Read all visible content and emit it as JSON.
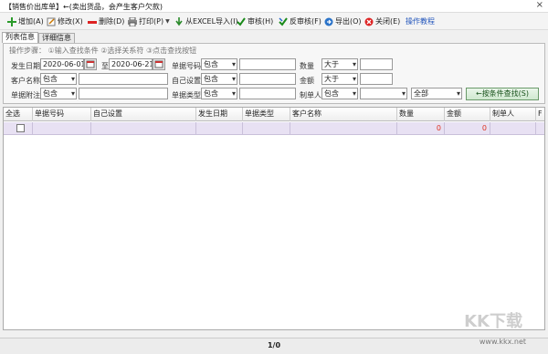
{
  "window": {
    "title": "【销售价出库单】←(卖出货品，会产生客户欠款)",
    "close": "×"
  },
  "toolbar": {
    "add": "增加(A)",
    "edit": "修改(X)",
    "delete": "删除(D)",
    "print": "打印(P)",
    "excel": "从EXCEL导入(I)",
    "audit": "审核(H)",
    "unaudit": "反审核(F)",
    "export": "导出(O)",
    "close": "关闭(E)",
    "tutorial": "操作教程"
  },
  "tabs": [
    "列表信息",
    "详细信息"
  ],
  "search": {
    "steps": "操作步骤：  ①输入查找条件  ②选择关系符  ③点击查找按钮",
    "date_label": "发生日期",
    "date_from": "2020-06-01",
    "to": "至",
    "date_to": "2020-06-21",
    "customer_label": "客户名称",
    "customer_op": "包含",
    "note_label": "单据附注",
    "note_op": "包含",
    "docno_label": "单据号码",
    "docno_op": "包含",
    "custom_label": "自己设置",
    "custom_op": "包含",
    "doctype_label": "单据类型",
    "doctype_op": "包含",
    "qty_label": "数量",
    "qty_op": "大于",
    "amount_label": "金额",
    "amount_op": "大于",
    "maker_label": "制单人",
    "maker_op": "包含",
    "all_value": "全部",
    "search_button": "←按条件查找(S)"
  },
  "grid": {
    "headers": [
      "全选",
      "单据号码",
      "自己设置",
      "发生日期",
      "单据类型",
      "客户名称",
      "数量",
      "金额",
      "制单人",
      "F"
    ],
    "row": {
      "qty": "0",
      "amount": "0"
    }
  },
  "status": {
    "page": "1/0"
  },
  "watermark": {
    "brand": "KK下载",
    "url": "www.kkx.net"
  },
  "icons": [
    "plus-icon",
    "edit-icon",
    "delete-icon",
    "print-icon",
    "excel-icon",
    "check-icon",
    "undo-check-icon",
    "export-icon",
    "close-icon",
    "calendar-icon"
  ]
}
